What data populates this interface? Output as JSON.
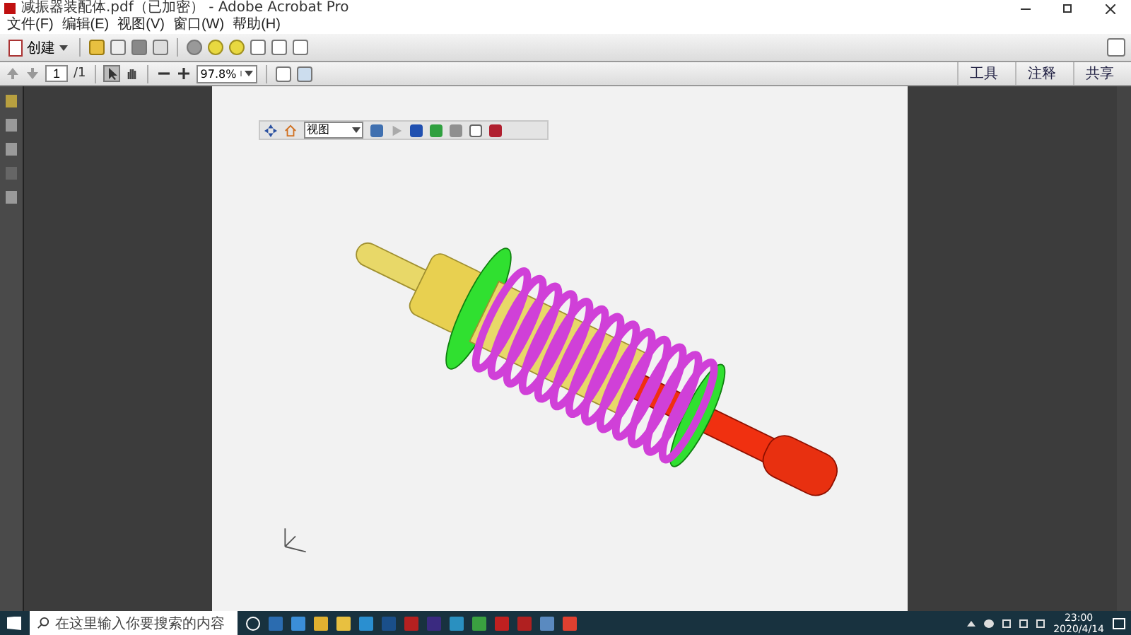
{
  "window": {
    "title": "减振器装配体.pdf（已加密） - Adobe Acrobat Pro"
  },
  "menu": [
    "文件(F)",
    "编辑(E)",
    "视图(V)",
    "窗口(W)",
    "帮助(H)"
  ],
  "toolbar": {
    "create_label": "创建"
  },
  "navigation": {
    "page": "1",
    "total": "/1",
    "zoom": "97.8%"
  },
  "panes": [
    "工具",
    "注释",
    "共享"
  ],
  "toolbar_3d": {
    "view": "视图"
  },
  "taskbar": {
    "search_placeholder": "在这里输入你要搜索的内容",
    "time": "23:00",
    "date": "2020/4/14"
  }
}
